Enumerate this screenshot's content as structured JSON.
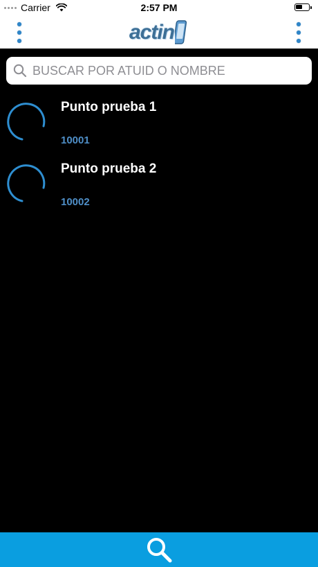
{
  "status_bar": {
    "carrier": "Carrier",
    "time": "2:57 PM",
    "battery_level": 0.5
  },
  "header": {
    "logo_text": "actin",
    "left_menu_icon": "vertical-dots-icon",
    "right_menu_icon": "vertical-dots-icon"
  },
  "search": {
    "placeholder": "BUSCAR POR ATUID O NOMBRE",
    "value": "",
    "icon": "search-icon"
  },
  "items": [
    {
      "title": "Punto prueba 1",
      "id": "10001",
      "icon": "loading-spinner-icon"
    },
    {
      "title": "Punto prueba 2",
      "id": "10002",
      "icon": "loading-spinner-icon"
    }
  ],
  "bottom_bar": {
    "icon": "search-icon"
  },
  "colors": {
    "accent": "#0a9ee0",
    "menu_dots": "#2f86c9",
    "id_text": "#4f8fc8",
    "spinner": "#2e8ed0",
    "background": "#000000"
  }
}
